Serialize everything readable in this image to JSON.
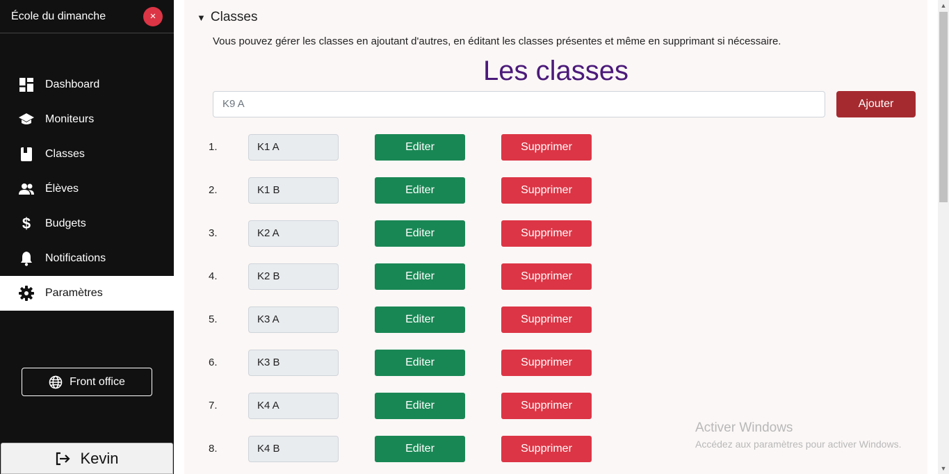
{
  "sidebar": {
    "title": "École du dimanche",
    "close_label": "×",
    "items": [
      {
        "label": "Dashboard",
        "icon": "dashboard-icon"
      },
      {
        "label": "Moniteurs",
        "icon": "graduation-cap-icon"
      },
      {
        "label": "Classes",
        "icon": "book-icon"
      },
      {
        "label": "Élèves",
        "icon": "users-icon"
      },
      {
        "label": "Budgets",
        "icon": "dollar-icon"
      },
      {
        "label": "Notifications",
        "icon": "bell-icon"
      },
      {
        "label": "Paramètres",
        "icon": "gear-icon",
        "active": true
      }
    ],
    "front_office_label": "Front office",
    "user_name": "Kevin"
  },
  "main": {
    "section_title": "Classes",
    "description": "Vous pouvez gérer les classes en ajoutant d'autres, en éditant les classes présentes et même en supprimant si nécessaire.",
    "page_title": "Les classes",
    "add_input_value": "K9 A",
    "add_button_label": "Ajouter",
    "edit_label": "Editer",
    "delete_label": "Supprimer",
    "classes": [
      {
        "num": "1.",
        "name": "K1 A"
      },
      {
        "num": "2.",
        "name": "K1 B"
      },
      {
        "num": "3.",
        "name": "K2 A"
      },
      {
        "num": "4.",
        "name": "K2 B"
      },
      {
        "num": "5.",
        "name": "K3 A"
      },
      {
        "num": "6.",
        "name": "K3 B"
      },
      {
        "num": "7.",
        "name": "K4 A"
      },
      {
        "num": "8.",
        "name": "K4 B"
      }
    ]
  },
  "watermark": {
    "line1": "Activer Windows",
    "line2": "Accédez aux paramètres pour activer Windows."
  },
  "colors": {
    "sidebar_bg": "#111111",
    "title_purple": "#4b1a7a",
    "add_button": "#a52a2f",
    "edit_button": "#198754",
    "delete_button": "#dc3545"
  }
}
